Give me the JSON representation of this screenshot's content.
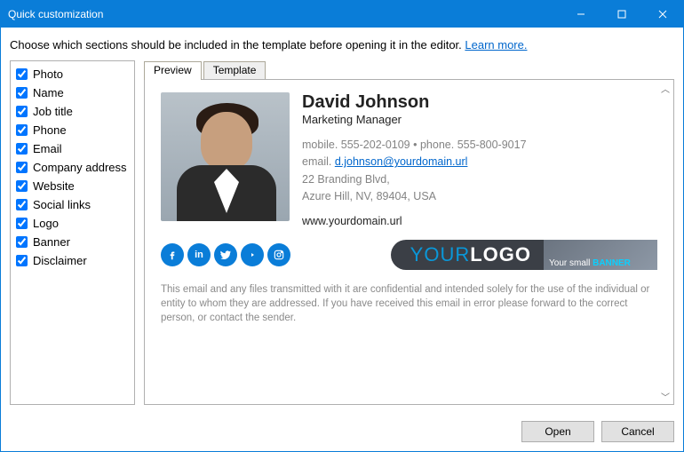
{
  "window": {
    "title": "Quick customization"
  },
  "description": {
    "text": "Choose which sections should be included in the template before opening it in the editor. ",
    "learn_more": "Learn more."
  },
  "sections": [
    {
      "label": "Photo",
      "checked": true
    },
    {
      "label": "Name",
      "checked": true
    },
    {
      "label": "Job title",
      "checked": true
    },
    {
      "label": "Phone",
      "checked": true
    },
    {
      "label": "Email",
      "checked": true
    },
    {
      "label": "Company address",
      "checked": true
    },
    {
      "label": "Website",
      "checked": true
    },
    {
      "label": "Social links",
      "checked": true
    },
    {
      "label": "Logo",
      "checked": true
    },
    {
      "label": "Banner",
      "checked": true
    },
    {
      "label": "Disclaimer",
      "checked": true
    }
  ],
  "tabs": {
    "preview": "Preview",
    "template": "Template"
  },
  "signature": {
    "name": "David Johnson",
    "title": "Marketing Manager",
    "mobile_label": "mobile.",
    "mobile": "555-202-0109",
    "phone_label": "phone.",
    "phone": "555-800-9017",
    "email_label": "email.",
    "email": "d.johnson@yourdomain.url",
    "address_line1": "22 Branding Blvd,",
    "address_line2": "Azure Hill, NV, 89404, USA",
    "website": "www.yourdomain.url",
    "logo_p1": "YOUR",
    "logo_p2": "LOGO",
    "banner_t1": "Your small ",
    "banner_t2": "BANNER",
    "disclaimer": "This email and any files transmitted with it are confidential and intended solely for the use of the individual or entity to whom they are addressed. If you have received this email in error please forward to the correct person, or contact the sender."
  },
  "social_icons": [
    "facebook",
    "linkedin",
    "twitter",
    "youtube",
    "instagram"
  ],
  "buttons": {
    "open": "Open",
    "cancel": "Cancel"
  }
}
